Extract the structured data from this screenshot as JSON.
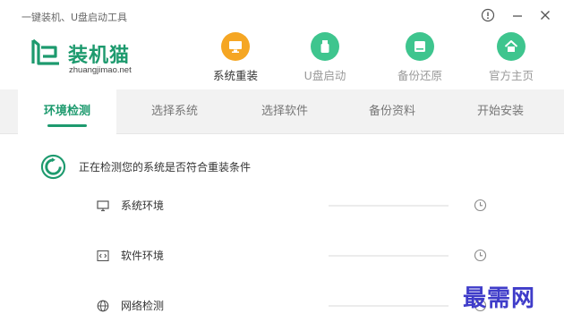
{
  "app": {
    "title": "一键装机、U盘启动工具"
  },
  "logo": {
    "name": "装机猫",
    "domain": "zhuangjimao.net"
  },
  "nav": [
    {
      "label": "系统重装",
      "icon": "monitor-icon",
      "color": "#f5a623",
      "active": true
    },
    {
      "label": "U盘启动",
      "icon": "usb-icon",
      "color": "#3ec58e",
      "active": false
    },
    {
      "label": "备份还原",
      "icon": "backup-drive-icon",
      "color": "#3ec58e",
      "active": false
    },
    {
      "label": "官方主页",
      "icon": "home-icon",
      "color": "#3ec58e",
      "active": false
    }
  ],
  "tabs": [
    {
      "label": "环境检测",
      "active": true
    },
    {
      "label": "选择系统",
      "active": false
    },
    {
      "label": "选择软件",
      "active": false
    },
    {
      "label": "备份资料",
      "active": false
    },
    {
      "label": "开始安装",
      "active": false
    }
  ],
  "status": {
    "text": "正在检测您的系统是否符合重装条件",
    "icon": "refresh-icon"
  },
  "checks": [
    {
      "label": "系统环境",
      "icon": "monitor-icon",
      "status_icon": "clock-icon"
    },
    {
      "label": "软件环境",
      "icon": "code-icon",
      "status_icon": "clock-icon"
    },
    {
      "label": "网络检测",
      "icon": "globe-icon",
      "status_icon": "clock-icon"
    }
  ],
  "watermark": {
    "text": "最需网"
  },
  "colors": {
    "brand": "#1d9a6e",
    "accent_orange": "#f5a623",
    "icon_green": "#3ec58e",
    "tab_bg": "#f2f2f2"
  }
}
